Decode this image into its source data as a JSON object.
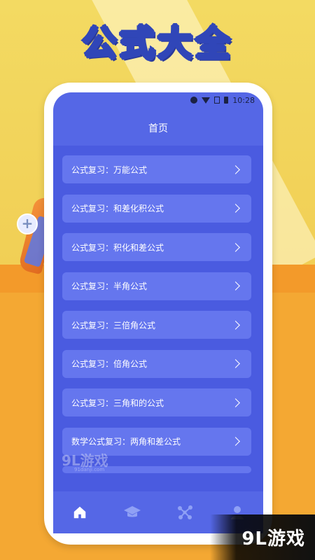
{
  "headline": "公式大全",
  "status_bar": {
    "time": "10:28"
  },
  "page_title": "首页",
  "list_items": [
    {
      "label": "公式复习：万能公式"
    },
    {
      "label": "公式复习：和差化积公式"
    },
    {
      "label": "公式复习：积化和差公式"
    },
    {
      "label": "公式复习：半角公式"
    },
    {
      "label": "公式复习：三倍角公式"
    },
    {
      "label": "公式复习：倍角公式"
    },
    {
      "label": "公式复习：三角和的公式"
    },
    {
      "label": "数学公式复习：两角和差公式"
    }
  ],
  "tabs": [
    {
      "icon": "home-icon",
      "active": true
    },
    {
      "icon": "graduation-cap-icon",
      "active": false
    },
    {
      "icon": "share-nodes-icon",
      "active": false
    },
    {
      "icon": "user-icon",
      "active": false
    }
  ],
  "watermark": {
    "center_text": "9L游戏",
    "center_sub": "91danji.com",
    "corner_text": "9L游戏"
  },
  "colors": {
    "screen_bg": "#5567e6",
    "card_bg": "#6576ee",
    "accent_yellow": "#f3da62",
    "accent_orange": "#f4a833",
    "headline_stroke": "#3046b8"
  }
}
